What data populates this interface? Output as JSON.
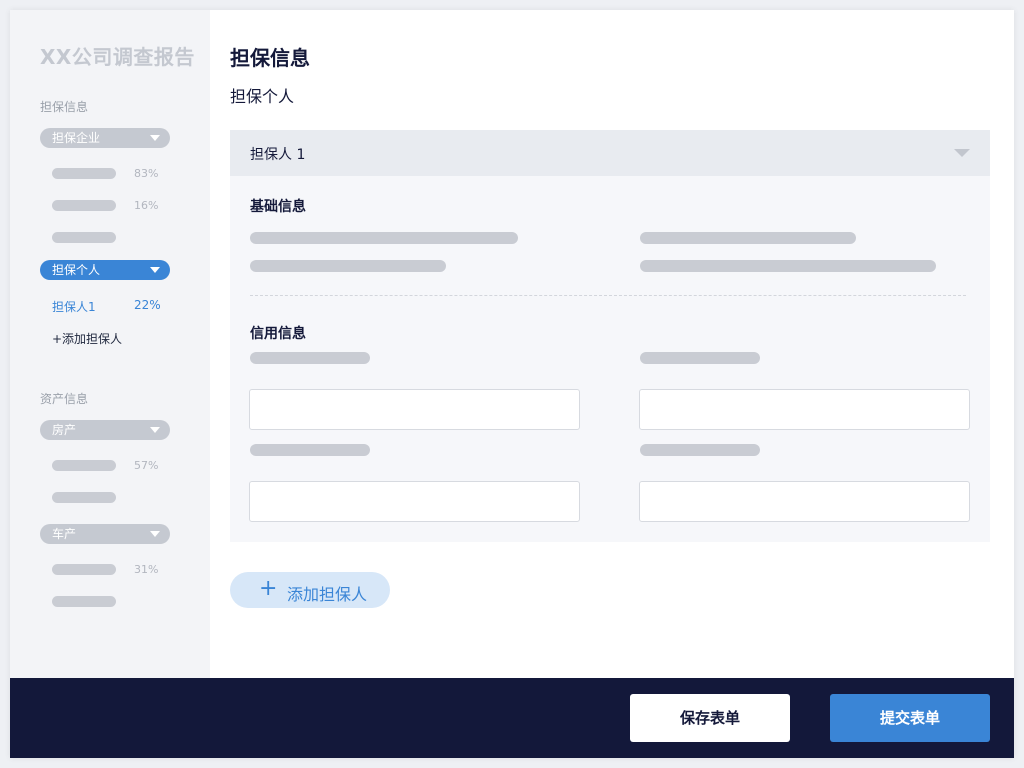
{
  "app": {
    "title": "XX公司调查报告"
  },
  "sidebar": {
    "sections": [
      {
        "label": "担保信息",
        "groups": [
          {
            "label": "担保企业",
            "progress": [
              "83%",
              "16%",
              ""
            ]
          },
          {
            "label": "担保个人",
            "items": [
              {
                "label": "担保人1",
                "pct": "22%"
              }
            ],
            "add_label": "+添加担保人"
          }
        ]
      },
      {
        "label": "资产信息",
        "groups": [
          {
            "label": "房产",
            "progress": [
              "57%",
              ""
            ]
          },
          {
            "label": "车产",
            "progress": [
              "31%",
              ""
            ]
          }
        ]
      }
    ]
  },
  "main": {
    "title": "担保信息",
    "subtitle": "担保个人",
    "panel": {
      "header": "担保人 1",
      "basic_label": "基础信息",
      "credit_label": "信用信息"
    },
    "add_button": "添加担保人"
  },
  "footer": {
    "save_label": "保存表单",
    "submit_label": "提交表单"
  },
  "colors": {
    "accent": "#3a85d6",
    "footer_bg": "#13183a",
    "sidebar_bg": "#f3f4f7"
  },
  "icons": {
    "dropdown": "triangle-down-icon",
    "add": "plus-icon"
  }
}
